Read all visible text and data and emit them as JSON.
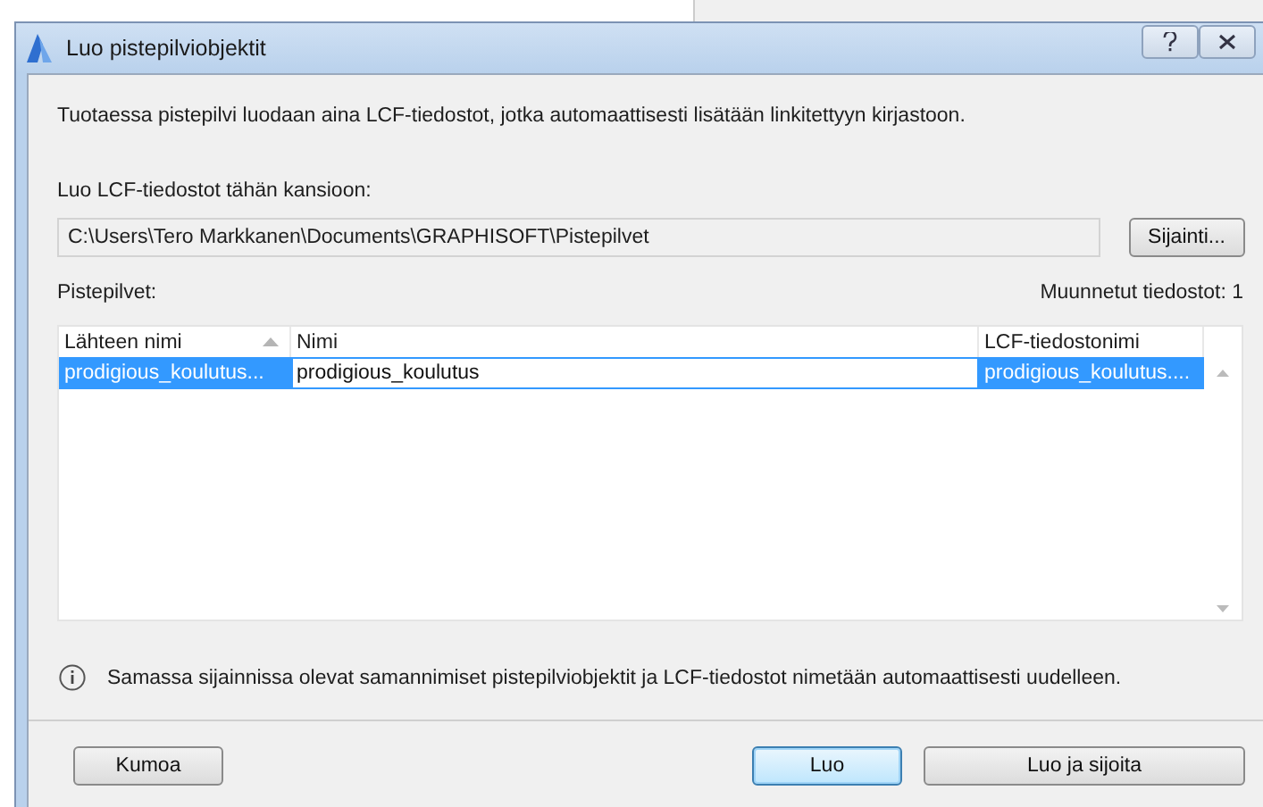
{
  "window": {
    "title": "Luo pistepilviobjektit"
  },
  "intro": "Tuotaessa pistepilvi luodaan aina LCF-tiedostot, jotka automaattisesti lisätään linkitettyyn kirjastoon.",
  "folder": {
    "label": "Luo LCF-tiedostot tähän kansioon:",
    "value": "C:\\Users\\Tero Markkanen\\Documents\\GRAPHISOFT\\Pistepilvet",
    "button": "Sijainti..."
  },
  "list_label": "Pistepilvet:",
  "changed_count": "Muunnetut tiedostot: 1",
  "table": {
    "columns": [
      {
        "label": "Lähteen nimi",
        "sorted": true
      },
      {
        "label": "Nimi",
        "sorted": false
      },
      {
        "label": "LCF-tiedostonimi",
        "sorted": false
      }
    ],
    "rows": [
      {
        "source": "prodigious_koulutus...",
        "name": "prodigious_koulutus",
        "lcf": "prodigious_koulutus....",
        "selected": true
      }
    ]
  },
  "info": "Samassa sijainnissa olevat samannimiset pistepilviobjektit ja LCF-tiedostot nimetään automaattisesti uudelleen.",
  "buttons": [
    {
      "label": "Kumoa",
      "default": false
    },
    {
      "label": "Luo",
      "default": true
    },
    {
      "label": "Luo ja sijoita",
      "default": false
    }
  ]
}
